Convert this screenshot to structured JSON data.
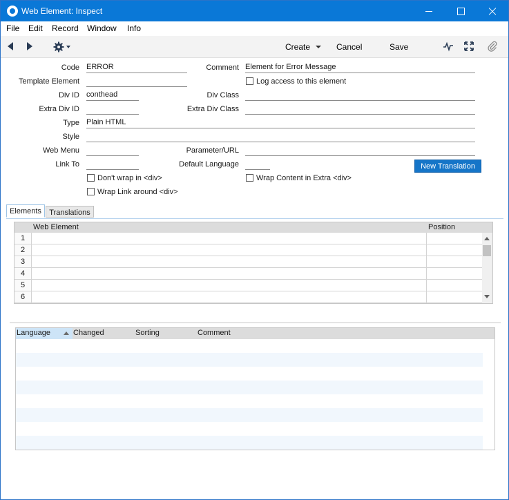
{
  "window": {
    "title": "Web Element: Inspect"
  },
  "menu": [
    "File",
    "Edit",
    "Record",
    "Window",
    "Info"
  ],
  "toolbar": {
    "create": "Create",
    "cancel": "Cancel",
    "save": "Save"
  },
  "form": {
    "code_label": "Code",
    "code_value": "ERROR",
    "comment_label": "Comment",
    "comment_value": "Element for Error Message",
    "template_label": "Template Element",
    "template_value": "",
    "log_access_label": "Log access to this element",
    "div_id_label": "Div ID",
    "div_id_value": "conthead",
    "div_class_label": "Div Class",
    "div_class_value": "",
    "extra_div_id_label": "Extra Div ID",
    "extra_div_id_value": "",
    "extra_div_class_label": "Extra Div Class",
    "extra_div_class_value": "",
    "type_label": "Type",
    "type_value": "Plain HTML",
    "style_label": "Style",
    "style_value": "",
    "web_menu_label": "Web Menu",
    "web_menu_value": "",
    "parameter_label": "Parameter/URL",
    "parameter_value": "",
    "link_to_label": "Link To",
    "link_to_value": "",
    "default_language_label": "Default Language",
    "default_language_value": "",
    "new_translation": "New Translation",
    "dont_wrap_label": "Don't wrap in <div>",
    "wrap_content_label": "Wrap Content in Extra <div>",
    "wrap_link_label": "Wrap Link around <div>"
  },
  "tabs": [
    "Elements",
    "Translations"
  ],
  "elements_grid": {
    "columns": [
      "Web Element",
      "Position"
    ],
    "rows": [
      "1",
      "2",
      "3",
      "4",
      "5",
      "6"
    ]
  },
  "translations_grid": {
    "columns": [
      "Language",
      "Changed",
      "Sorting",
      "Comment"
    ]
  }
}
